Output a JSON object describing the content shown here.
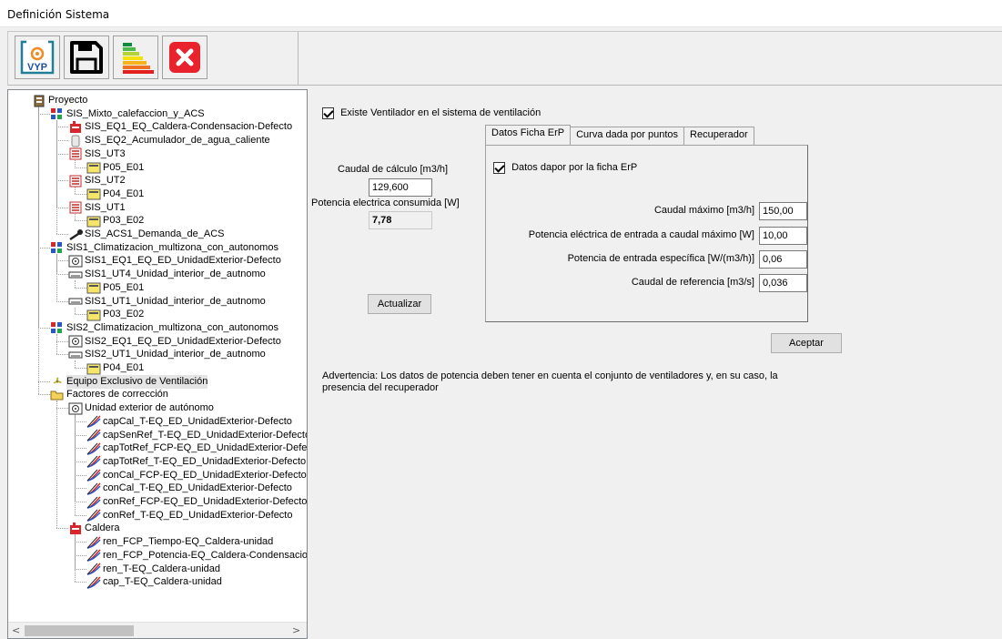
{
  "window": {
    "title": "Definición Sistema"
  },
  "toolbar": {
    "logo_text": "VYP",
    "buttons": [
      {
        "name": "vyp-logo-button",
        "icon": "vyp-logo-icon"
      },
      {
        "name": "save-button",
        "icon": "floppy-disk-icon"
      },
      {
        "name": "energy-rating-button",
        "icon": "energy-rating-icon"
      },
      {
        "name": "close-button",
        "icon": "red-x-icon"
      }
    ]
  },
  "tree": [
    {
      "label": "Proyecto",
      "icon": "project-icon"
    },
    {
      "label": "SIS_Mixto_calefaccion_y_ACS",
      "icon": "system-icon"
    },
    {
      "label": "SIS_EQ1_EQ_Caldera-Condensacion-Defecto",
      "icon": "boiler-icon"
    },
    {
      "label": "SIS_EQ2_Acumulador_de_agua_caliente",
      "icon": "tank-icon"
    },
    {
      "label": "SIS_UT3",
      "icon": "radiator-icon"
    },
    {
      "label": "P05_E01",
      "icon": "space-icon"
    },
    {
      "label": "SIS_UT2",
      "icon": "radiator-icon"
    },
    {
      "label": "P04_E01",
      "icon": "space-icon"
    },
    {
      "label": "SIS_UT1",
      "icon": "radiator-icon"
    },
    {
      "label": "P03_E02",
      "icon": "space-icon"
    },
    {
      "label": "SIS_ACS1_Demanda_de_ACS",
      "icon": "shower-icon"
    },
    {
      "label": "SIS1_Climatizacion_multizona_con_autonomos",
      "icon": "system-icon"
    },
    {
      "label": "SIS1_EQ1_EQ_ED_UnidadExterior-Defecto",
      "icon": "outdoor-unit-icon"
    },
    {
      "label": "SIS1_UT4_Unidad_interior_de_autnomo",
      "icon": "indoor-unit-icon"
    },
    {
      "label": "P05_E01",
      "icon": "space-icon"
    },
    {
      "label": "SIS1_UT1_Unidad_interior_de_autnomo",
      "icon": "indoor-unit-icon"
    },
    {
      "label": "P03_E02",
      "icon": "space-icon"
    },
    {
      "label": "SIS2_Climatizacion_multizona_con_autonomos",
      "icon": "system-icon"
    },
    {
      "label": "SIS2_EQ1_EQ_ED_UnidadExterior-Defecto",
      "icon": "outdoor-unit-icon"
    },
    {
      "label": "SIS2_UT1_Unidad_interior_de_autnomo",
      "icon": "indoor-unit-icon"
    },
    {
      "label": "P04_E01",
      "icon": "space-icon"
    },
    {
      "label": "Equipo Exclusivo de Ventilación",
      "icon": "fan-icon",
      "selected": true
    },
    {
      "label": "Factores de corrección",
      "icon": "folder-open-icon"
    },
    {
      "label": "Unidad exterior de autónomo",
      "icon": "outdoor-unit-icon"
    },
    {
      "label": "capCal_T-EQ_ED_UnidadExterior-Defecto",
      "icon": "curve-icon"
    },
    {
      "label": "capSenRef_T-EQ_ED_UnidadExterior-Defecto",
      "icon": "curve-icon"
    },
    {
      "label": "capTotRef_FCP-EQ_ED_UnidadExterior-Defec",
      "icon": "curve-icon"
    },
    {
      "label": "capTotRef_T-EQ_ED_UnidadExterior-Defecto",
      "icon": "curve-icon"
    },
    {
      "label": "conCal_FCP-EQ_ED_UnidadExterior-Defecto",
      "icon": "curve-icon"
    },
    {
      "label": "conCal_T-EQ_ED_UnidadExterior-Defecto",
      "icon": "curve-icon"
    },
    {
      "label": "conRef_FCP-EQ_ED_UnidadExterior-Defecto",
      "icon": "curve-icon"
    },
    {
      "label": "conRef_T-EQ_ED_UnidadExterior-Defecto",
      "icon": "curve-icon"
    },
    {
      "label": "Caldera",
      "icon": "boiler-icon"
    },
    {
      "label": "ren_FCP_Tiempo-EQ_Caldera-unidad",
      "icon": "curve-icon"
    },
    {
      "label": "ren_FCP_Potencia-EQ_Caldera-Condensacion",
      "icon": "curve-icon"
    },
    {
      "label": "ren_T-EQ_Caldera-unidad",
      "icon": "curve-icon"
    },
    {
      "label": "cap_T-EQ_Caldera-unidad",
      "icon": "curve-icon"
    }
  ],
  "main": {
    "fan_exists_label": "Existe Ventilador en el sistema de ventilación",
    "fan_exists_checked": true,
    "caudal_calculo_label": "Caudal de cálculo [m3/h]",
    "caudal_calculo_value": "129,600",
    "potencia_consumida_label": "Potencia electrica consumida [W]",
    "potencia_consumida_value": "7,78",
    "actualizar_label": "Actualizar",
    "tabs": [
      {
        "label": "Datos Ficha ErP",
        "active": true
      },
      {
        "label": "Curva dada por puntos",
        "active": false
      },
      {
        "label": "Recuperador",
        "active": false
      }
    ],
    "erp": {
      "datos_label": "Datos dapor por la ficha ErP",
      "datos_checked": true,
      "caudal_maximo_label": "Caudal máximo [m3/h]",
      "caudal_maximo_value": "150,00",
      "potencia_entrada_label": "Potencia eléctrica de entrada a caudal máximo [W]",
      "potencia_entrada_value": "10,00",
      "potencia_especifica_label": "Potencia de entrada específica [W/(m3/h)]",
      "potencia_especifica_value": "0,06",
      "caudal_referencia_label": "Caudal de referencia [m3/s]",
      "caudal_referencia_value": "0,036"
    },
    "aceptar_label": "Aceptar",
    "advertencia_line1": "Advertencia: Los datos de potencia deben tener en cuenta el conjunto de ventiladores y, en su caso, la",
    "advertencia_line2": "presencia del recuperador"
  }
}
